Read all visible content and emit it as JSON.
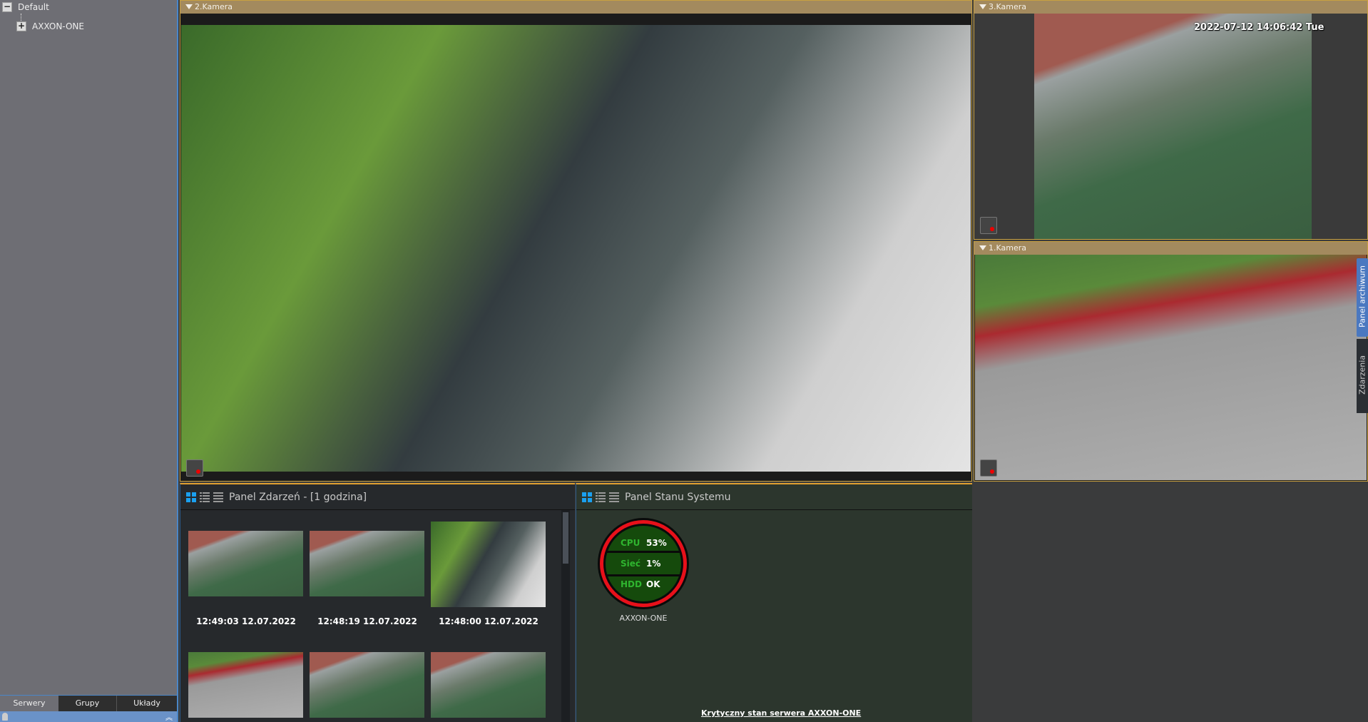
{
  "sidebar": {
    "tree": [
      {
        "label": "Default",
        "toggle": "−"
      },
      {
        "label": "AXXON-ONE",
        "toggle": "+"
      }
    ],
    "tabs": [
      "Serwery",
      "Grupy",
      "Układy"
    ],
    "active_tab": "Serwery"
  },
  "cameras": {
    "cam2": {
      "title": "2.Kamera"
    },
    "cam3": {
      "title": "3.Kamera",
      "overlay": "2022-07-12 14:06:42 Tue"
    },
    "cam1": {
      "title": "1.Kamera"
    }
  },
  "side_tabs": {
    "archive": "Panel archiwum",
    "events": "Zdarzenia"
  },
  "events_panel": {
    "title": "Panel Zdarzeń - [1 godzina]",
    "events": [
      {
        "time": "12:49:03 12.07.2022",
        "camera": "3.Kamera"
      },
      {
        "time": "12:48:19 12.07.2022",
        "camera": "3.Kamera"
      },
      {
        "time": "12:48:00 12.07.2022",
        "camera": "2.Kamera"
      },
      {
        "time": "",
        "camera": "1.Kamera"
      },
      {
        "time": "",
        "camera": "3.Kamera"
      },
      {
        "time": "",
        "camera": "3.Kamera"
      }
    ]
  },
  "system_panel": {
    "title": "Panel Stanu Systemu",
    "server": "AXXON-ONE",
    "metrics": [
      {
        "label": "CPU",
        "value": "53%"
      },
      {
        "label": "Sieć",
        "value": "1%"
      },
      {
        "label": "HDD",
        "value": "OK"
      }
    ],
    "status_color": "#e8101a",
    "alert_link": "Krytyczny stan serwera AXXON-ONE"
  },
  "colors": {
    "accent": "#1aa0f0",
    "cam_header": "#a38a5e",
    "metric_label": "#2fb52f"
  }
}
